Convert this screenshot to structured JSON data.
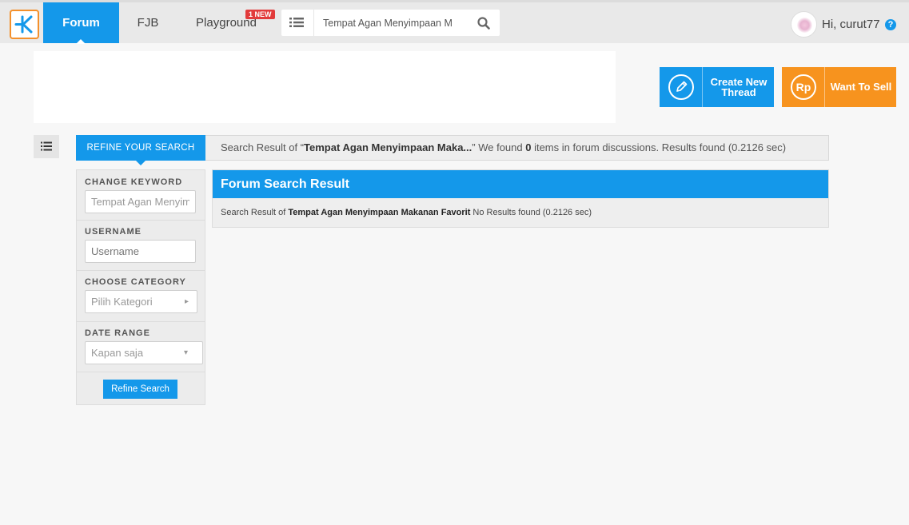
{
  "nav": {
    "logo": "kaskus-logo-icon",
    "items": [
      {
        "label": "Forum",
        "active": true
      },
      {
        "label": "FJB",
        "active": false
      },
      {
        "label": "Playground",
        "active": false
      }
    ],
    "new_badge": "1 NEW",
    "search_value": "Tempat Agan Menyimpaan M",
    "user_greeting": "Hi, curut77",
    "help_glyph": "?"
  },
  "actions": {
    "create_thread_line1": "Create New",
    "create_thread_line2": "Thread",
    "want_to_sell": "Want To Sell",
    "sell_icon_text": "Rp"
  },
  "refine": {
    "tab_label": "REFINE YOUR SEARCH",
    "keyword_label": "CHANGE KEYWORD",
    "keyword_value": "Tempat Agan Menyimpaan Makanan Favorit",
    "username_label": "USERNAME",
    "username_placeholder": "Username",
    "category_label": "CHOOSE CATEGORY",
    "category_value": "Pilih Kategori",
    "date_label": "DATE RANGE",
    "date_value": "Kapan saja",
    "button_label": "Refine Search"
  },
  "summary": {
    "prefix": "Search Result of “",
    "query": "Tempat Agan Menyimpaan Maka...",
    "mid": "” We found ",
    "count": "0",
    "suffix": " items in forum discussions. Results found (0.2126 sec)"
  },
  "result": {
    "title": "Forum Search Result",
    "prefix": "Search Result of ",
    "query": "Tempat Agan Menyimpaan Makanan Favorit",
    "suffix": " No Results found (0.2126 sec)"
  },
  "colors": {
    "primary": "#1498ea",
    "accent_orange": "#f7931e",
    "logo_orange": "#f4902b",
    "badge_red": "#e23b3b"
  }
}
